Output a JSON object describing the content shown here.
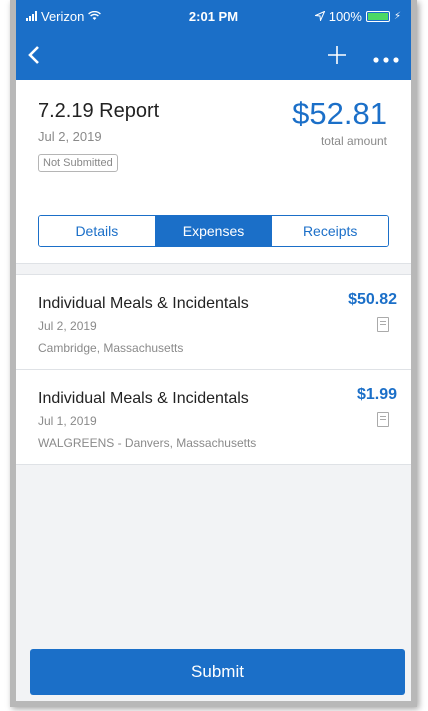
{
  "status": {
    "carrier": "Verizon",
    "time": "2:01 PM",
    "battery": "100%"
  },
  "nav": {
    "back_icon": "chevron-left-icon",
    "add_icon": "plus-icon",
    "more_icon": "more-icon"
  },
  "report": {
    "title": "7.2.19 Report",
    "date": "Jul 2, 2019",
    "status_badge": "Not Submitted",
    "total": "$52.81",
    "total_label": "total amount"
  },
  "tabs": [
    {
      "label": "Details",
      "active": false
    },
    {
      "label": "Expenses",
      "active": true
    },
    {
      "label": "Receipts",
      "active": false
    }
  ],
  "expenses": [
    {
      "name": "Individual Meals & Incidentals",
      "date": "Jul 2, 2019",
      "location": "Cambridge, Massachusetts",
      "amount": "$50.82"
    },
    {
      "name": "Individual Meals & Incidentals",
      "date": "Jul 1, 2019",
      "location": "WALGREENS - Danvers, Massachusetts",
      "amount": "$1.99"
    }
  ],
  "submit_label": "Submit",
  "colors": {
    "accent": "#1b6fc8",
    "battery": "#4cd964"
  }
}
